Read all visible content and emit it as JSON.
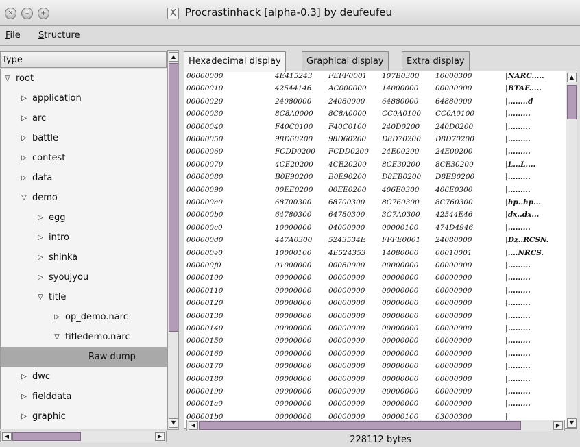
{
  "window": {
    "title": "Procrastinhack [alpha-0.3] by deufeufeu",
    "app_icon": "X",
    "buttons": [
      "close",
      "minimize",
      "maximize"
    ]
  },
  "menu": {
    "file": {
      "mnemonic": "F",
      "rest": "ile"
    },
    "structure": {
      "mnemonic": "S",
      "rest": "tructure"
    }
  },
  "tree": {
    "header": "Type",
    "rows": [
      {
        "label": "root",
        "arrow": "▽"
      },
      {
        "label": "application",
        "arrow": "▷"
      },
      {
        "label": "arc",
        "arrow": "▷"
      },
      {
        "label": "battle",
        "arrow": "▷"
      },
      {
        "label": "contest",
        "arrow": "▷"
      },
      {
        "label": "data",
        "arrow": "▷"
      },
      {
        "label": "demo",
        "arrow": "▽"
      },
      {
        "label": "egg",
        "arrow": "▷"
      },
      {
        "label": "intro",
        "arrow": "▷"
      },
      {
        "label": "shinka",
        "arrow": "▷"
      },
      {
        "label": "syoujyou",
        "arrow": "▷"
      },
      {
        "label": "title",
        "arrow": "▽"
      },
      {
        "label": "op_demo.narc",
        "arrow": "▷"
      },
      {
        "label": "titledemo.narc",
        "arrow": "▽"
      },
      {
        "label": "Raw dump",
        "arrow": ""
      },
      {
        "label": "dwc",
        "arrow": "▷"
      },
      {
        "label": "fielddata",
        "arrow": "▷"
      },
      {
        "label": "graphic",
        "arrow": "▷"
      }
    ],
    "selected": "Raw dump"
  },
  "tabs": [
    "Hexadecimal display",
    "Graphical display",
    "Extra display"
  ],
  "active_tab": "Hexadecimal display",
  "hex_rows": [
    [
      "00000000",
      "4E415243",
      "FEFF0001",
      "107B0300",
      "10000300",
      "|NARC....."
    ],
    [
      "00000010",
      "42544146",
      "AC000000",
      "14000000",
      "00000000",
      "|BTAF....."
    ],
    [
      "00000020",
      "24080000",
      "24080000",
      "64880000",
      "64880000",
      "|........d"
    ],
    [
      "00000030",
      "8C8A0000",
      "8C8A0000",
      "CC0A0100",
      "CC0A0100",
      "|........."
    ],
    [
      "00000040",
      "F40C0100",
      "F40C0100",
      "240D0200",
      "240D0200",
      "|........."
    ],
    [
      "00000050",
      "98D60200",
      "98D60200",
      "D8D70200",
      "D8D70200",
      "|........."
    ],
    [
      "00000060",
      "FCDD0200",
      "FCDD0200",
      "24E00200",
      "24E00200",
      "|........."
    ],
    [
      "00000070",
      "4CE20200",
      "4CE20200",
      "8CE30200",
      "8CE30200",
      "|L...L...."
    ],
    [
      "00000080",
      "B0E90200",
      "B0E90200",
      "D8EB0200",
      "D8EB0200",
      "|........."
    ],
    [
      "00000090",
      "00EE0200",
      "00EE0200",
      "406E0300",
      "406E0300",
      "|........."
    ],
    [
      "000000a0",
      "68700300",
      "68700300",
      "8C760300",
      "8C760300",
      "|hp..hp..."
    ],
    [
      "000000b0",
      "64780300",
      "64780300",
      "3C7A0300",
      "42544E46",
      "|dx..dx..."
    ],
    [
      "000000c0",
      "10000000",
      "04000000",
      "00000100",
      "474D4946",
      "|........."
    ],
    [
      "000000d0",
      "447A0300",
      "5243534E",
      "FFFE0001",
      "24080000",
      "|Dz..RCSN."
    ],
    [
      "000000e0",
      "10000100",
      "4E524353",
      "14080000",
      "00010001",
      "|....NRCS."
    ],
    [
      "000000f0",
      "01000000",
      "00080000",
      "00000000",
      "00000000",
      "|........."
    ],
    [
      "00000100",
      "00000000",
      "00000000",
      "00000000",
      "00000000",
      "|........."
    ],
    [
      "00000110",
      "00000000",
      "00000000",
      "00000000",
      "00000000",
      "|........."
    ],
    [
      "00000120",
      "00000000",
      "00000000",
      "00000000",
      "00000000",
      "|........."
    ],
    [
      "00000130",
      "00000000",
      "00000000",
      "00000000",
      "00000000",
      "|........."
    ],
    [
      "00000140",
      "00000000",
      "00000000",
      "00000000",
      "00000000",
      "|........."
    ],
    [
      "00000150",
      "00000000",
      "00000000",
      "00000000",
      "00000000",
      "|........."
    ],
    [
      "00000160",
      "00000000",
      "00000000",
      "00000000",
      "00000000",
      "|........."
    ],
    [
      "00000170",
      "00000000",
      "00000000",
      "00000000",
      "00000000",
      "|........."
    ],
    [
      "00000180",
      "00000000",
      "00000000",
      "00000000",
      "00000000",
      "|........."
    ],
    [
      "00000190",
      "00000000",
      "00000000",
      "00000000",
      "00000000",
      "|........."
    ],
    [
      "000001a0",
      "00000000",
      "00000000",
      "00000000",
      "00000000",
      "|........."
    ],
    [
      "000001b0",
      "00000000",
      "00000000",
      "00000100",
      "03000300",
      "|"
    ]
  ],
  "status": "228112 bytes",
  "colors": {
    "scroll_thumb": "#b39cb8",
    "selection": "#a9a9a9",
    "window_bg": "#dedede"
  }
}
